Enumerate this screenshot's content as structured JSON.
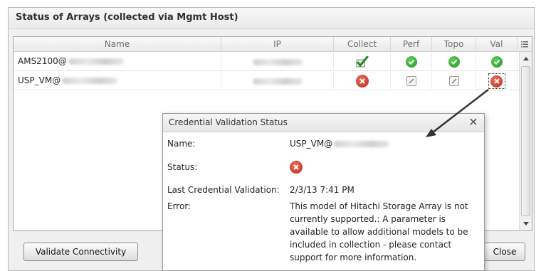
{
  "panel": {
    "title": "Status of Arrays (collected via Mgmt Host)"
  },
  "grid": {
    "columns": [
      "Name",
      "IP",
      "Collect",
      "Perf",
      "Topo",
      "Val"
    ],
    "rows": [
      {
        "name": "AMS2100@",
        "collect": "check-edit-icon",
        "perf": "success",
        "topo": "success",
        "val": "success"
      },
      {
        "name": "USP_VM@",
        "collect": "error",
        "perf": "edit",
        "topo": "edit",
        "val": "error-selected"
      }
    ]
  },
  "buttons": {
    "validate": "Validate Connectivity",
    "close": "Close"
  },
  "dialog": {
    "title": "Credential Validation Status",
    "name_label": "Name:",
    "name_value": "USP_VM@",
    "status_label": "Status:",
    "last_label": "Last Credential Validation:",
    "last_value": "2/3/13 7:41 PM",
    "error_label": "Error:",
    "error_value": "This model of Hitachi Storage Array is not currently supported.: A parameter is available to allow additional models to be included in collection - please contact support for more information."
  },
  "colors": {
    "success": "#2aa22a",
    "error": "#d0321f",
    "arrow": "#333333"
  }
}
